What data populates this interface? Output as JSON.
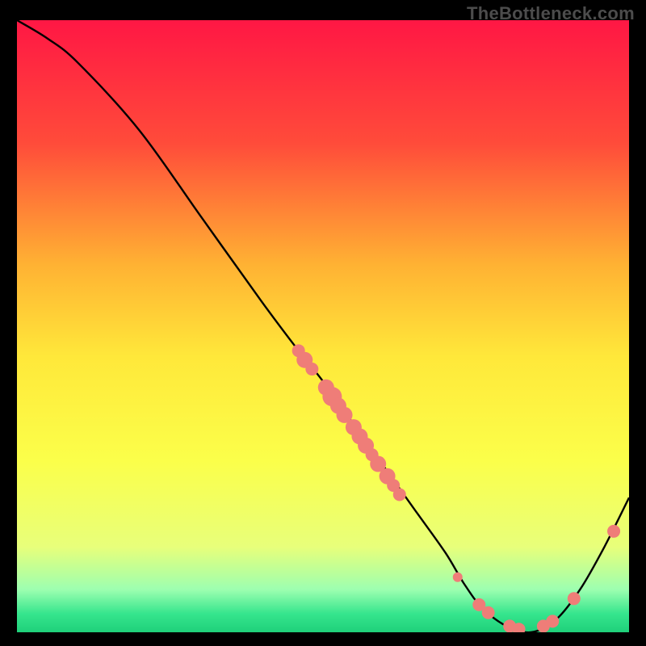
{
  "watermark": "TheBottleneck.com",
  "chart_data": {
    "type": "line",
    "title": "",
    "xlabel": "",
    "ylabel": "",
    "xlim": [
      0,
      100
    ],
    "ylim": [
      0,
      100
    ],
    "gradient_stops": [
      {
        "offset": 0,
        "color": "#ff1744"
      },
      {
        "offset": 20,
        "color": "#ff4b3a"
      },
      {
        "offset": 40,
        "color": "#ffb233"
      },
      {
        "offset": 55,
        "color": "#ffe83a"
      },
      {
        "offset": 72,
        "color": "#fbff4a"
      },
      {
        "offset": 86,
        "color": "#e8ff7a"
      },
      {
        "offset": 93,
        "color": "#9dffb0"
      },
      {
        "offset": 97,
        "color": "#35e58d"
      },
      {
        "offset": 100,
        "color": "#1fd07a"
      }
    ],
    "series": [
      {
        "name": "curve",
        "x": [
          0,
          5,
          10,
          20,
          30,
          40,
          46,
          50,
          55,
          60,
          65,
          70,
          73,
          76,
          80,
          84,
          88,
          92,
          96,
          100
        ],
        "y": [
          100,
          97,
          93,
          82,
          68,
          54,
          46,
          41,
          34,
          27,
          20,
          13,
          8,
          4,
          1,
          0,
          2,
          7,
          14,
          22
        ]
      }
    ],
    "marker_color": "#ef7d78",
    "markers": [
      {
        "x": 46.0,
        "y": 46.0,
        "r": 8
      },
      {
        "x": 47.0,
        "y": 44.5,
        "r": 10
      },
      {
        "x": 48.2,
        "y": 43.0,
        "r": 8
      },
      {
        "x": 50.5,
        "y": 40.0,
        "r": 10
      },
      {
        "x": 51.5,
        "y": 38.5,
        "r": 12
      },
      {
        "x": 52.5,
        "y": 37.0,
        "r": 10
      },
      {
        "x": 53.5,
        "y": 35.5,
        "r": 10
      },
      {
        "x": 55.0,
        "y": 33.5,
        "r": 10
      },
      {
        "x": 56.0,
        "y": 32.0,
        "r": 10
      },
      {
        "x": 57.0,
        "y": 30.5,
        "r": 10
      },
      {
        "x": 58.0,
        "y": 29.0,
        "r": 8
      },
      {
        "x": 59.0,
        "y": 27.5,
        "r": 10
      },
      {
        "x": 60.5,
        "y": 25.5,
        "r": 10
      },
      {
        "x": 61.5,
        "y": 24.0,
        "r": 8
      },
      {
        "x": 62.5,
        "y": 22.5,
        "r": 8
      },
      {
        "x": 72.0,
        "y": 9.0,
        "r": 6
      },
      {
        "x": 75.5,
        "y": 4.5,
        "r": 8
      },
      {
        "x": 77.0,
        "y": 3.2,
        "r": 8
      },
      {
        "x": 80.5,
        "y": 1.0,
        "r": 8
      },
      {
        "x": 82.0,
        "y": 0.5,
        "r": 8
      },
      {
        "x": 86.0,
        "y": 1.0,
        "r": 8
      },
      {
        "x": 87.5,
        "y": 1.8,
        "r": 8
      },
      {
        "x": 91.0,
        "y": 5.5,
        "r": 8
      },
      {
        "x": 97.5,
        "y": 16.5,
        "r": 8
      }
    ]
  }
}
